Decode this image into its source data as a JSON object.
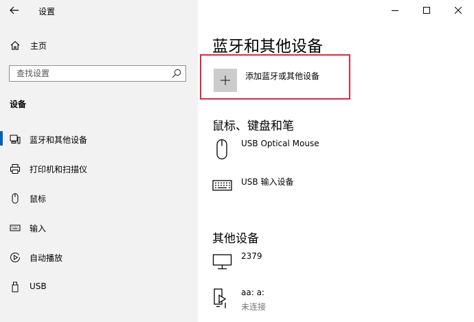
{
  "window": {
    "title": "设置",
    "controls": {
      "minimize": "minimize-icon",
      "maximize": "maximize-icon",
      "close": "close-icon"
    }
  },
  "sidebar": {
    "home_label": "主页",
    "search": {
      "placeholder": "查找设置"
    },
    "section_heading": "设备",
    "items": [
      {
        "label": "蓝牙和其他设备",
        "icon": "bluetooth-devices-icon",
        "selected": true
      },
      {
        "label": "打印机和扫描仪",
        "icon": "printer-icon",
        "selected": false
      },
      {
        "label": "鼠标",
        "icon": "mouse-icon",
        "selected": false
      },
      {
        "label": "输入",
        "icon": "keyboard-icon",
        "selected": false
      },
      {
        "label": "自动播放",
        "icon": "autoplay-icon",
        "selected": false
      },
      {
        "label": "USB",
        "icon": "usb-icon",
        "selected": false
      }
    ]
  },
  "main": {
    "page_title": "蓝牙和其他设备",
    "add_device_label": "添加蓝牙或其他设备",
    "mouse_keyboard_section": {
      "heading": "鼠标、键盘和笔",
      "devices": [
        {
          "name": "USB Optical Mouse",
          "icon": "mouse-icon"
        },
        {
          "name": "USB 输入设备",
          "icon": "keyboard-icon"
        }
      ]
    },
    "other_devices_section": {
      "heading": "其他设备",
      "devices": [
        {
          "name": "2379",
          "icon": "monitor-icon"
        },
        {
          "name": "aa: a:",
          "status": "未连接",
          "icon": "media-device-icon"
        }
      ]
    }
  },
  "colors": {
    "sidebar_bg": "#f2f2f2",
    "accent": "#0063b1",
    "highlight_border": "#e0283c",
    "secondary_text": "#767676"
  }
}
